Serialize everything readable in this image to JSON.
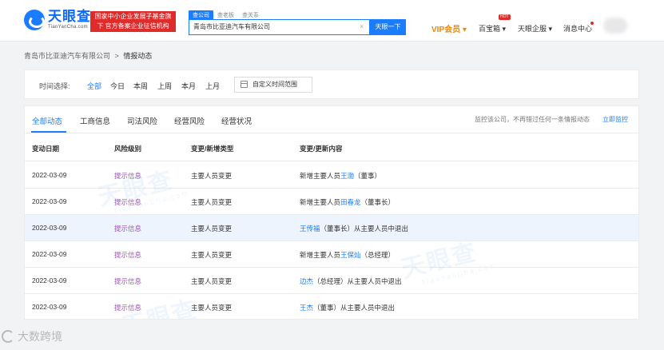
{
  "header": {
    "logo_cn": "天眼查",
    "logo_en": "TianYanCha.com",
    "red_badge": "国家中小企业发展子基金旗下 官方备案企业征信机构",
    "search_tabs": [
      "查公司",
      "查老板",
      "查关系"
    ],
    "search_value": "青岛市比亚迪汽车有限公司",
    "search_button": "天眼一下",
    "vip_label": "VIP会员",
    "nav": [
      "百宝箱",
      "天眼企服",
      "消息中心"
    ],
    "hot_badge": "HOT"
  },
  "breadcrumb": {
    "company": "青岛市比亚迪汽车有限公司",
    "separator": ">",
    "current": "情报动态"
  },
  "filter": {
    "label": "时间选择:",
    "options": [
      "全部",
      "今日",
      "本周",
      "上周",
      "本月",
      "上月"
    ],
    "selected": "全部",
    "custom_range": "自定义时间范围"
  },
  "tabs": {
    "items": [
      "全部动态",
      "工商信息",
      "司法风险",
      "经营风险",
      "经营状况"
    ],
    "active": "全部动态",
    "monitor_text": "监控该公司，不再错过任何一条情报动态",
    "monitor_link": "立即监控"
  },
  "table": {
    "headers": [
      "变动日期",
      "风险级别",
      "变更/新增类型",
      "变更/更新内容"
    ],
    "rows": [
      {
        "date": "2022-03-09",
        "level": "提示信息",
        "type": "主要人员变更",
        "pre": "新增主要人员",
        "name": "王渤",
        "post": "（董事）"
      },
      {
        "date": "2022-03-09",
        "level": "提示信息",
        "type": "主要人员变更",
        "pre": "新增主要人员",
        "name": "田春龙",
        "post": "（董事长）"
      },
      {
        "date": "2022-03-09",
        "level": "提示信息",
        "type": "主要人员变更",
        "pre": "",
        "name": "王传福",
        "post": "（董事长）从主要人员中退出"
      },
      {
        "date": "2022-03-09",
        "level": "提示信息",
        "type": "主要人员变更",
        "pre": "新增主要人员",
        "name": "王保灿",
        "post": "（总经理）"
      },
      {
        "date": "2022-03-09",
        "level": "提示信息",
        "type": "主要人员变更",
        "pre": "",
        "name": "边杰",
        "post": "（总经理）从主要人员中退出"
      },
      {
        "date": "2022-03-09",
        "level": "提示信息",
        "type": "主要人员变更",
        "pre": "",
        "name": "王杰",
        "post": "（董事）从主要人员中退出"
      }
    ]
  },
  "watermark": {
    "brand": "天眼查",
    "brand_en": "TianYanCha.com",
    "bottom": "大数跨境"
  },
  "colors": {
    "accent": "#1a7cff",
    "vip": "#e8870e",
    "badge_red": "#e02b2b",
    "risk_level": "#9b59b6"
  }
}
